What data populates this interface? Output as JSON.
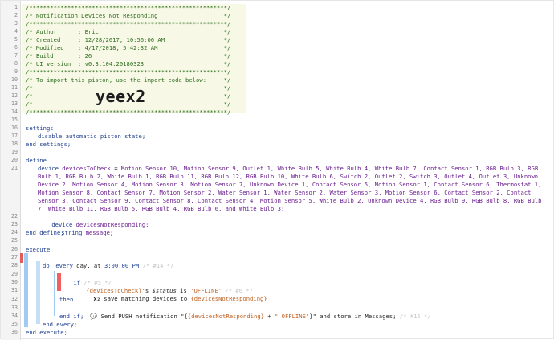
{
  "header": {
    "border": "/*********************************************************/",
    "title": "/* Notification Devices Not Responding                   */",
    "author": "/* Author      : Eric                                    */",
    "created": "/* Created     : 12/28/2017, 10:56:06 AM                 */",
    "modified": "/* Modified    : 4/17/2018, 5:42:32 AM                   */",
    "build": "/* Build       : 26                                      */",
    "ui_version": "/* UI version  : v0.3.104.20180323                       */",
    "import_note": "/* To import this piston, use the import code below:     */",
    "blank": "/*                                                       */",
    "import_code": "yeex2"
  },
  "code": {
    "settings": "settings",
    "disable_auto": "disable automatic piston state;",
    "end_settings": "end settings;",
    "define": "define",
    "device_kw": "device",
    "devices_var": "devicesToCheck",
    "equals": " = ",
    "device_list": "Motion Sensor 10, Motion Sensor 9, Outlet 1, White Bulb 5, White Bulb 4, White Bulb 7, Contact Sensor 1, RGB Bulb 3, RGB Bulb 1, RGB Bulb 2, White Bulb 1, RGB Bulb 11, RGB Bulb 12, RGB Bulb 10, White Bulb 6, Switch 2, Outlet 2, Switch 3, Outlet 4, Outlet 3, Unknown Device 2, Motion Sensor 4, Motion Sensor 3, Motion Sensor 7, Unknown Device 1, Contact Sensor 5, Motion Sensor 1, Contact Sensor 6, Thermostat 1, Motion Sensor 8, Contact Sensor 7, Motion Sensor 2, Water Sensor 1, Water Sensor 2, Water Sensor 3, Motion Sensor 6, Contact Sensor 2, Contact Sensor 3, Contact Sensor 9, Contact Sensor 8, Contact Sensor 4, Motion Sensor 5, White Bulb 2, Unknown Device 4, RGB Bulb 9, RGB Bulb 8, RGB Bulb 7, White Bulb 11, RGB Bulb 5, RGB Bulb 4, RGB Bulb 6, and White Bulb 3;",
    "device_kw2": "device",
    "not_resp_var": "devicesNotResponding;",
    "string_kw": "string",
    "message_var": "message;",
    "end_define": "end define;",
    "execute": "execute",
    "every": "every",
    "day_at": " day, at ",
    "time": "3:00:00 PM",
    "c14": " /* #14 */",
    "do": "do",
    "if": "if",
    "c5": " /* #5 */",
    "cond_var": "{devicesToCheck}",
    "cond_mid": "'s ",
    "status": "$status",
    "is": " is ",
    "offline": "'OFFLINE'",
    "c6": " /* #6 */",
    "save_icon": "x₂",
    "save_text": " save matching devices to ",
    "save_var": "{devicesNotResponding}",
    "then": "then",
    "push_icon": "💬",
    "push_text": " Send PUSH notification \"",
    "push_expr_open": "{",
    "push_var": "{devicesNotResponding}",
    "push_plus": " + ",
    "push_str": "\" OFFLINE\"",
    "push_expr_close": "}",
    "push_end": "\" and store in Messages;",
    "c15": " /* #15 */",
    "end_if": "end if;",
    "end_every": "end every;",
    "end_execute": "end execute;"
  },
  "line_numbers": [
    "1",
    "2",
    "3",
    "4",
    "5",
    "6",
    "7",
    "8",
    "9",
    "10",
    "11",
    "12",
    "13",
    "14",
    "15",
    "16",
    "17",
    "18",
    "19",
    "20",
    "21",
    "22",
    "23",
    "24",
    "25",
    "26",
    "27",
    "28",
    "29",
    "30",
    "31",
    "32",
    "33",
    "34",
    "35",
    "36"
  ],
  "colors": {
    "comment": "#2e6e1e",
    "keyword": "#1f3f8f",
    "device": "#6b1e8f",
    "string": "#c06020",
    "header_bg": "#f7f8e6",
    "condition_bar": "#f06060",
    "block_bar": "#9fcbf2"
  }
}
